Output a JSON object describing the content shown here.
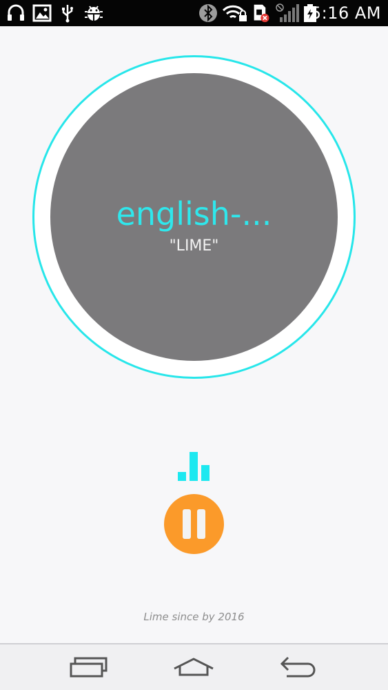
{
  "status_bar": {
    "time": "5:16 AM",
    "icons": [
      "headphones-icon",
      "image-icon",
      "usb-icon",
      "android-debug-icon",
      "bluetooth-icon",
      "wifi-lock-icon",
      "sim-error-icon",
      "no-signal-icon",
      "battery-charging-icon"
    ]
  },
  "player": {
    "title": "english-...",
    "subtitle": "\"LIME\"",
    "ring_color": "#27e6ea",
    "disc_color": "#7b7a7c",
    "title_color": "#2fe7ec"
  },
  "equalizer": {
    "color": "#1de8f0",
    "bar_levels": [
      0.3,
      1.0,
      0.55
    ]
  },
  "controls": {
    "pause_button_color": "#fb9a2a",
    "pause_icon": "pause-icon"
  },
  "footer": {
    "text": "Lime since by 2016"
  },
  "nav_bar": {
    "icons": [
      "recent-apps-icon",
      "home-icon",
      "back-icon"
    ]
  }
}
